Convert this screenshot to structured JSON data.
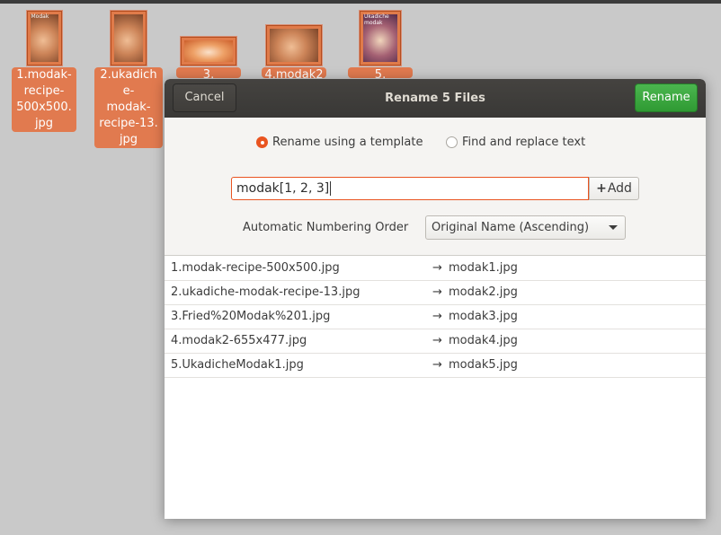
{
  "desktop": {
    "files": [
      {
        "label": "1.modak-recipe-500x500.jpg",
        "label_lines": [
          "1.modak-",
          "recipe-",
          "500x500.",
          "jpg"
        ],
        "thumb_tag": "Modak",
        "thumb_kind": "warm"
      },
      {
        "label": "2.ukadiche-modak-recipe-13.jpg",
        "label_lines": [
          "2.ukadiche-",
          "modak-",
          "recipe-13.",
          "jpg"
        ],
        "thumb_tag": "",
        "thumb_kind": "warm"
      },
      {
        "label": "3.",
        "label_lines": [
          "3."
        ],
        "thumb_tag": "",
        "thumb_kind": "plate"
      },
      {
        "label": "4.modak2-",
        "label_lines": [
          "4.modak2-"
        ],
        "thumb_tag": "",
        "thumb_kind": "warm"
      },
      {
        "label": "5.",
        "label_lines": [
          "5."
        ],
        "thumb_tag": "Ukadiche modak",
        "thumb_kind": "dark"
      }
    ]
  },
  "dialog": {
    "title": "Rename 5 Files",
    "cancel_label": "Cancel",
    "rename_label": "Rename",
    "mode_options": [
      {
        "label": "Rename using a template",
        "selected": true
      },
      {
        "label": "Find and replace text",
        "selected": false
      }
    ],
    "template_value": "modak[1, 2, 3]",
    "add_label": "Add",
    "add_icon": "plus-icon",
    "numbering_label": "Automatic Numbering Order",
    "numbering_selected": "Original Name (Ascending)",
    "arrow_glyph": "→",
    "rows": [
      {
        "old": "1.modak-recipe-500x500.jpg",
        "new": "modak1.jpg"
      },
      {
        "old": "2.ukadiche-modak-recipe-13.jpg",
        "new": "modak2.jpg"
      },
      {
        "old": "3.Fried%20Modak%201.jpg",
        "new": "modak3.jpg"
      },
      {
        "old": "4.modak2-655x477.jpg",
        "new": "modak4.jpg"
      },
      {
        "old": "5.UkadicheModak1.jpg",
        "new": "modak5.jpg"
      }
    ]
  },
  "colors": {
    "accent": "#e95420",
    "rename_button": "#3aa83e",
    "header": "#3f3d3a",
    "desktop_bg": "#c9c9c9",
    "file_label_bg": "#e17a4f"
  }
}
